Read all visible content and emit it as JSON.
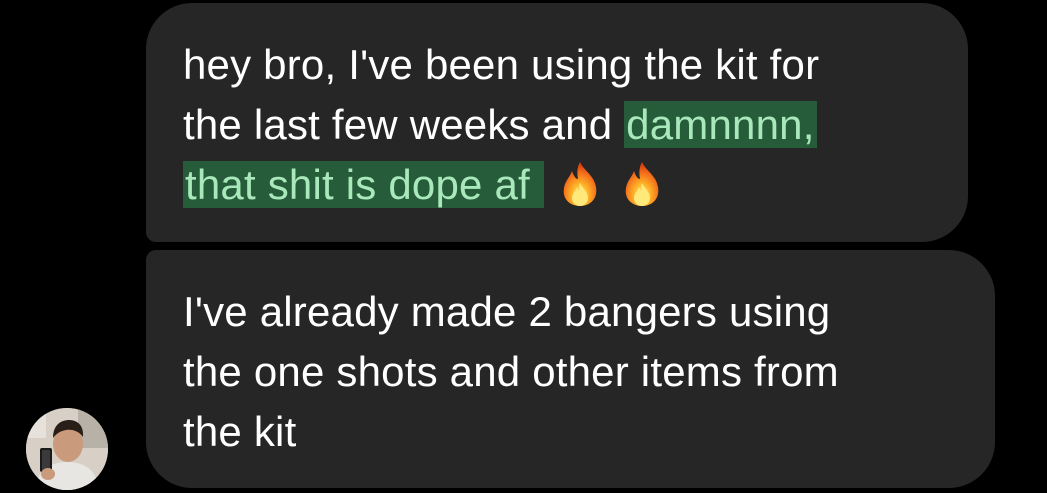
{
  "thread": {
    "messages": [
      {
        "lines": [
          {
            "text": "hey bro, I've been using the kit for"
          },
          {
            "text": "the last few weeks and ",
            "highlight": "damnnnn,"
          },
          {
            "highlight": "that shit is dope af ",
            "emojis": [
              "fire-icon",
              "fire-icon"
            ]
          }
        ]
      },
      {
        "lines": [
          {
            "text": "I've already made 2 bangers using"
          },
          {
            "text": "the one shots and other items from"
          },
          {
            "text": "the kit"
          }
        ]
      }
    ],
    "sender": {
      "avatar": "user-avatar-photo"
    }
  },
  "colors": {
    "background": "#000000",
    "bubble": "#262626",
    "text": "#ffffff",
    "highlight_bg": "#275c3a",
    "highlight_text": "#a8e8bb"
  }
}
